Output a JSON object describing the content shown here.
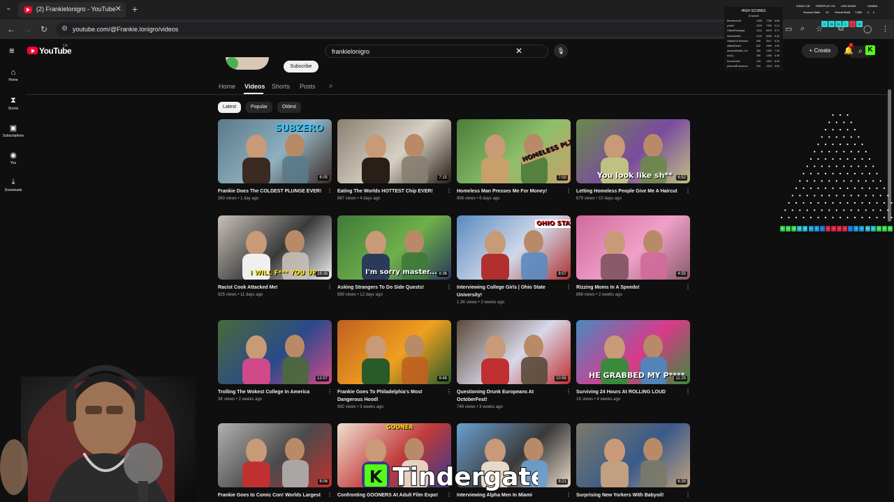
{
  "browser": {
    "tab_title": "(2) Frankielonigro - YouTube",
    "url": "youtube.com/@Frankie.lonigro/videos"
  },
  "youtube": {
    "logo_text": "YouTube",
    "logo_country": "CA",
    "search_query": "frankielonigro",
    "create_label": "Create",
    "notif_count": "2",
    "subscribe_label": "Subscribe",
    "sidebar": [
      {
        "label": "Home",
        "icon": "home-icon"
      },
      {
        "label": "Shorts",
        "icon": "shorts-icon"
      },
      {
        "label": "Subscriptions",
        "icon": "subscriptions-icon"
      },
      {
        "label": "You",
        "icon": "you-icon"
      },
      {
        "label": "Downloads",
        "icon": "download-icon"
      }
    ],
    "channel_tabs": [
      "Home",
      "Videos",
      "Shorts",
      "Posts"
    ],
    "chips": [
      "Latest",
      "Popular",
      "Oldest"
    ],
    "videos": [
      {
        "title": "Frankie Does The COLDEST PLUNGE EVER!",
        "meta": "360 views • 1 day ago",
        "duration": "6:05",
        "overlay": "SUBZERO"
      },
      {
        "title": "Eating The Worlds HOTTEST Chip EVER!",
        "meta": "887 views • 4 days ago",
        "duration": "7:15",
        "overlay": ""
      },
      {
        "title": "Homeless Man Presses Me For Money!",
        "meta": "908 views • 6 days ago",
        "duration": "7:02",
        "overlay": "HOMELESS PLZ HELP $$$$"
      },
      {
        "title": "Letting Homeless People Give Me A Haircut",
        "meta": "679 views • 10 days ago",
        "duration": "6:52",
        "overlay": "You look like sh**"
      },
      {
        "title": "Racist Cook Attacked Me!",
        "meta": "925 views • 11 days ago",
        "duration": "16:16",
        "overlay": "I WILL F*** YOU UP"
      },
      {
        "title": "Asking Strangers To Do Side Quests!",
        "meta": "889 views • 12 days ago",
        "duration": "8:36",
        "overlay": "I'm sorry master..."
      },
      {
        "title": "Interviewing College Girls | Ohio State University!",
        "meta": "1.3K views • 2 weeks ago",
        "duration": "8:07",
        "overlay": "OHIO STATE"
      },
      {
        "title": "Rizzing Moms In A Speedo!",
        "meta": "868 views • 2 weeks ago",
        "duration": "4:55",
        "overlay": ""
      },
      {
        "title": "Trolling The Wokest College In America",
        "meta": "3K views • 2 weeks ago",
        "duration": "12:07",
        "overlay": ""
      },
      {
        "title": "Frankie Goes To Philadelphia's Most Dangerous Hood!",
        "meta": "992 views • 3 weeks ago",
        "duration": "9:48",
        "overlay": ""
      },
      {
        "title": "Questioning Drunk Europeans At OctoberFest!",
        "meta": "749 views • 3 weeks ago",
        "duration": "10:55",
        "overlay": ""
      },
      {
        "title": "Surviving 24 Hours At ROLLING LOUD",
        "meta": "1K views • 4 weeks ago",
        "duration": "11:25",
        "overlay": "HE GRABBED MY P****"
      },
      {
        "title": "Frankie Goes to Comic Con! Worlds Largest",
        "meta": "",
        "duration": "8:06",
        "overlay": ""
      },
      {
        "title": "Confronting GOONERS At Adult Film Expo!",
        "meta": "",
        "duration": "",
        "overlay": "GOONER"
      },
      {
        "title": "Interviewing Alpha Men In Miami",
        "meta": "",
        "duration": "8:21",
        "overlay": ""
      },
      {
        "title": "Surprising New Yorkers With Babyoil!",
        "meta": "",
        "duration": "6:39",
        "overlay": ""
      }
    ]
  },
  "stream_overlay": {
    "kick_banner": "Tindergate",
    "highscores": {
      "title": "HIGH SCORES",
      "subtitle": "Channel",
      "rows": [
        [
          "Berdesours8",
          "1328",
          "7768",
          "5.85"
        ],
        [
          "yow44",
          "1229",
          "7493",
          "6.14"
        ],
        [
          "OfficialTindergat",
          "1132",
          "6575",
          "5.71"
        ],
        [
          "SubleVertiko",
          "1175",
          "6266",
          "5.42"
        ],
        [
          "VBackDoTheNama",
          "695",
          "3617",
          "5.20"
        ],
        [
          "abiliedDedra",
          "642",
          "2999",
          "4.69"
        ],
        [
          "woeandertable_0zr",
          "280",
          "1399",
          "7.00"
        ],
        [
          "ea11y",
          "255",
          "1365",
          "5.35"
        ],
        [
          "frozenLizzle",
          "218",
          "1313",
          "6.25"
        ],
        [
          "personalFrancesco",
          "240",
          "1318",
          "5.60"
        ]
      ]
    },
    "status": {
      "kinko": "KINKO ON",
      "freeplay": "FREEPLAY ON",
      "usd_mode": "USD MODE",
      "gamba": "GAMBA",
      "session_balls_label": "Session Balls",
      "session_balls": "15",
      "overall_balls_label": "Overall Balls",
      "overall_balls": "7,885",
      "last_a": "0",
      "last_b": "0"
    },
    "multipliers_top": [
      "1",
      "36",
      "31",
      "1",
      "-1",
      "36"
    ],
    "slots": [
      "80",
      "30",
      "35",
      "20",
      "25",
      "10",
      "5",
      "1",
      "-1",
      "-2",
      "-1",
      "-1",
      "1",
      "5",
      "10",
      "25",
      "20",
      "35",
      "30",
      "80"
    ]
  }
}
